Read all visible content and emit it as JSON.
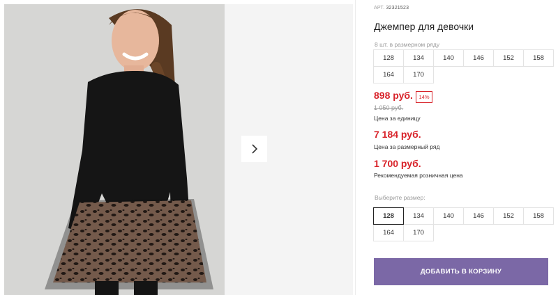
{
  "gallery": {
    "photo_alt": "Джемпер для девочки",
    "next_icon": "chevron-right-icon"
  },
  "product": {
    "article_label": "АРТ.",
    "article_number": "32321523",
    "title": "Джемпер для девочки",
    "pack_hint": "8 шт. в размерном ряду",
    "pack_sizes": [
      "128",
      "134",
      "140",
      "146",
      "152",
      "158",
      "164",
      "170"
    ],
    "price_unit": "898 руб.",
    "discount_badge": "14%",
    "old_price": "1 050 руб.",
    "price_unit_label": "Цена за единицу",
    "price_pack": "7 184 руб.",
    "price_pack_label": "Цена за размерный ряд",
    "price_retail": "1 700 руб.",
    "price_retail_label": "Рекомендуемая розничная цена",
    "choose_size_label": "Выберите размер:",
    "sizes": [
      "128",
      "134",
      "140",
      "146",
      "152",
      "158",
      "164",
      "170"
    ],
    "selected_size": "128",
    "add_to_cart": "ДОБАВИТЬ В КОРЗИНУ"
  },
  "colors": {
    "accent_red": "#d8232a",
    "button_purple": "#7b68a6"
  }
}
